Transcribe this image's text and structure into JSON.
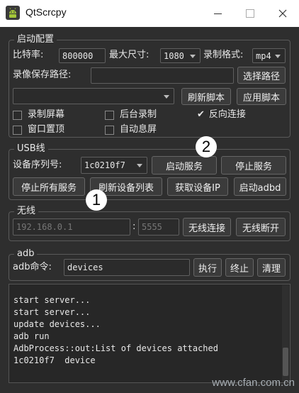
{
  "window": {
    "title": "QtScrcpy"
  },
  "startup": {
    "title": "启动配置",
    "bitrate_label": "比特率:",
    "bitrate_value": "800000",
    "maxsize_label": "最大尺寸:",
    "maxsize_value": "1080",
    "format_label": "录制格式:",
    "format_value": "mp4",
    "save_path_label": "录像保存路径:",
    "save_path_value": "",
    "select_path_button": "选择路径",
    "script_value": "",
    "refresh_script_button": "刷新脚本",
    "apply_script_button": "应用脚本",
    "checkboxes": {
      "record_screen": {
        "label": "录制屏幕",
        "checked": false
      },
      "background_record": {
        "label": "后台录制",
        "checked": false
      },
      "reverse_connect": {
        "label": "反向连接",
        "checked": true
      },
      "always_on_top": {
        "label": "窗口置顶",
        "checked": false
      },
      "auto_screen_off": {
        "label": "自动息屏",
        "checked": false
      }
    }
  },
  "usb": {
    "title": "USB线",
    "serial_label": "设备序列号:",
    "serial_value": "1c0210f7",
    "start_service_button": "启动服务",
    "stop_service_button": "停止服务",
    "stop_all_button": "停止所有服务",
    "refresh_devices_button": "刷新设备列表",
    "get_ip_button": "获取设备IP",
    "start_adbd_button": "启动adbd"
  },
  "wireless": {
    "title": "无线",
    "ip_value": "192.168.0.1",
    "separator": ":",
    "port_value": "5555",
    "connect_button": "无线连接",
    "disconnect_button": "无线断开"
  },
  "adb": {
    "title": "adb",
    "command_label": "adb命令:",
    "command_value": "devices",
    "execute_button": "执行",
    "terminate_button": "终止",
    "clear_button": "清理"
  },
  "log_lines": [
    "start server...",
    "start server...",
    "update devices...",
    "adb run",
    "AdbProcess::out:List of devices attached",
    "1c0210f7  device"
  ],
  "callouts": {
    "one": "1",
    "two": "2"
  },
  "watermark": "www.cfan.com.cn",
  "colors": {
    "background": "#2e2e2e",
    "titlebar": "#ffffff",
    "android_green": "#a4c639"
  }
}
